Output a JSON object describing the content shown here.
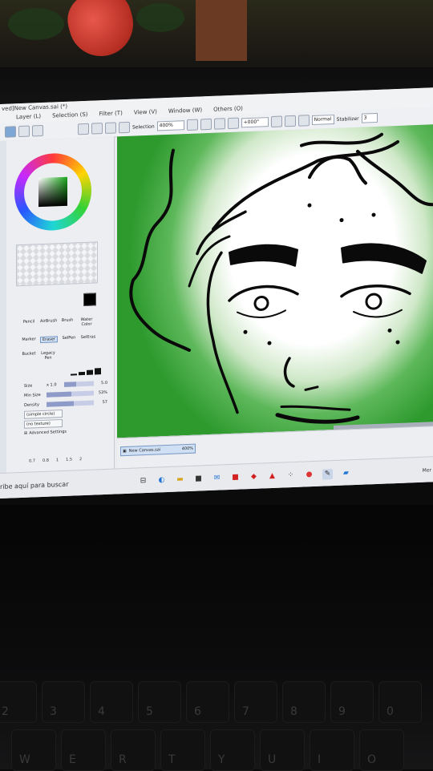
{
  "window": {
    "title": "ved]New Canvas.sai (*)"
  },
  "menu": {
    "items": [
      "Layer (L)",
      "Selection (S)",
      "Filter (T)",
      "View (V)",
      "Window (W)",
      "Others (O)"
    ]
  },
  "toolbar": {
    "selection_label": "Selection",
    "zoom_value": "400%",
    "rotation_value": "+000°",
    "blend_mode": "Normal",
    "stabilizer_label": "Stabilizer",
    "stabilizer_value": "3"
  },
  "tools": {
    "row1": [
      "Pencil",
      "AirBrush",
      "Brush",
      "Water Color"
    ],
    "row2": [
      "Marker",
      "Eraser",
      "SelPen",
      "SelEras"
    ],
    "row3": [
      "Bucket",
      "Legacy Pen"
    ],
    "active": "Eraser"
  },
  "brush_settings": {
    "size_label": "Size",
    "size_multiplier": "x 1.0",
    "size_value": "5.0",
    "min_size_label": "Min Size",
    "min_size_value": "53%",
    "min_size_fraction": 0.53,
    "density_label": "Density",
    "density_value": "57",
    "density_fraction": 0.57,
    "shape_option": "(simple circle)",
    "texture_option": "(no texture)",
    "advanced_label": "Advanced Settings",
    "preset_sizes": [
      "0.7",
      "0.8",
      "1",
      "1.5",
      "2"
    ]
  },
  "layers": {
    "items": [
      {
        "name": "New Canvas.sai",
        "zoom": "400%"
      }
    ]
  },
  "taskbar": {
    "search_text": "ribe aquí para buscar",
    "right_text": "Mer"
  },
  "keyboard": {
    "row_top": [
      "2",
      "3",
      "4",
      "5",
      "6",
      "7",
      "8",
      "9",
      "0"
    ],
    "row_letters": [
      "W",
      "E",
      "R",
      "T",
      "Y",
      "U",
      "I",
      "O"
    ]
  },
  "colors": {
    "canvas_green": "#2e9a2e",
    "accent_blue": "#7fa7d6",
    "active_tool": "#cfe0f5"
  }
}
